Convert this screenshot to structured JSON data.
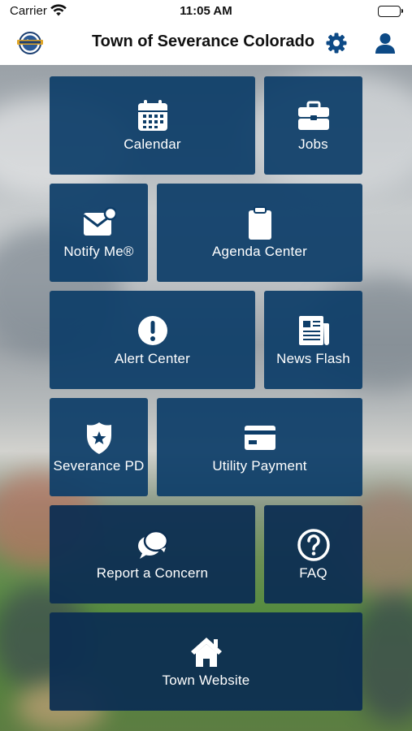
{
  "status_bar": {
    "carrier": "Carrier",
    "time": "11:05 AM"
  },
  "header": {
    "title": "Town of Severance Colorado",
    "logo_icon": "town-seal-logo",
    "settings_icon": "gear-icon",
    "account_icon": "user-icon",
    "accent_color": "#0d4a86"
  },
  "tiles": [
    {
      "label": "Calendar",
      "icon": "calendar-icon"
    },
    {
      "label": "Jobs",
      "icon": "briefcase-icon"
    },
    {
      "label": "Notify Me®",
      "icon": "mail-notification-icon"
    },
    {
      "label": "Agenda Center",
      "icon": "clipboard-icon"
    },
    {
      "label": "Alert Center",
      "icon": "alert-icon"
    },
    {
      "label": "News Flash",
      "icon": "newspaper-icon"
    },
    {
      "label": "Severance PD",
      "icon": "police-badge-icon"
    },
    {
      "label": "Utility Payment",
      "icon": "credit-card-icon"
    },
    {
      "label": "Report a Concern",
      "icon": "chat-bubbles-icon"
    },
    {
      "label": "FAQ",
      "icon": "question-icon"
    },
    {
      "label": "Town Website",
      "icon": "home-icon"
    }
  ],
  "colors": {
    "tile_background": "#0d3d68",
    "tile_text": "#ffffff"
  }
}
